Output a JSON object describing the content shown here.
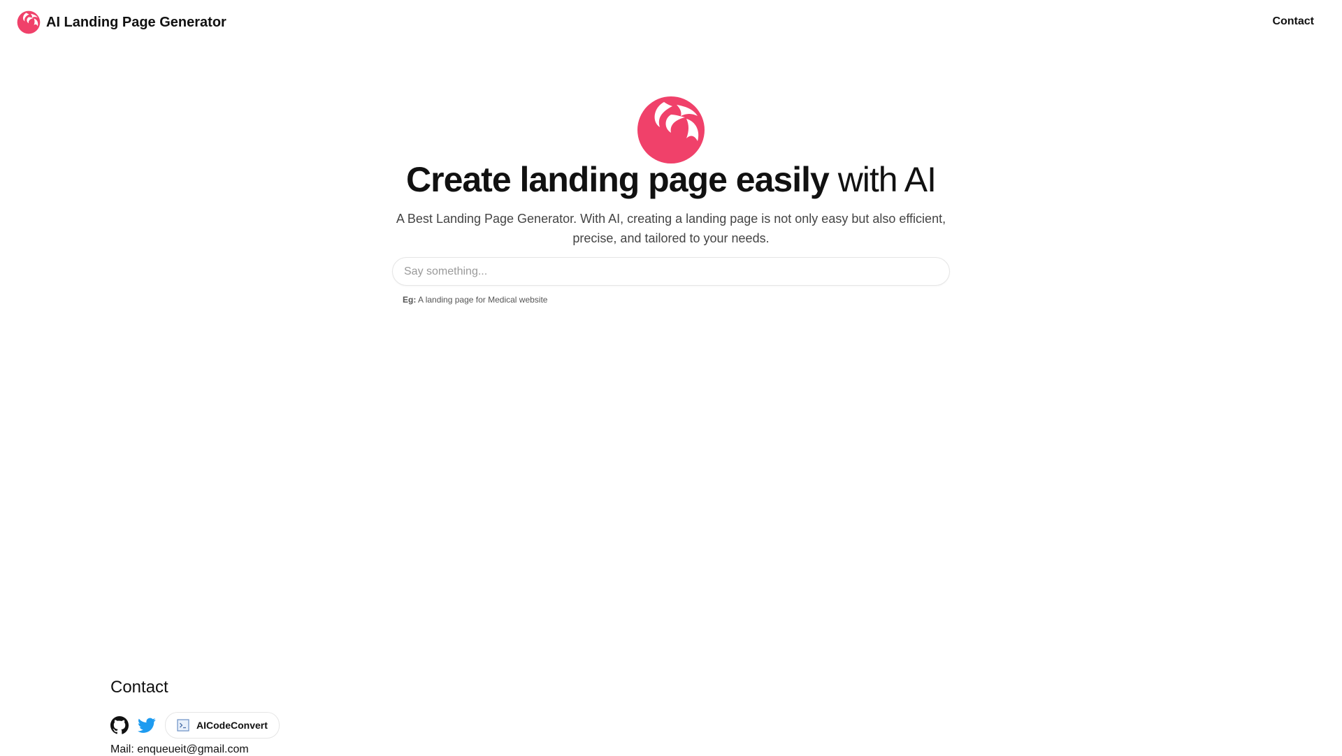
{
  "header": {
    "title": "AI Landing Page Generator",
    "contact_label": "Contact"
  },
  "hero": {
    "headline_bold": "Create landing page easily",
    "headline_light": "with AI",
    "subtitle": "A Best Landing Page Generator. With AI, creating a landing page is not only easy but also efficient, precise, and tailored to your needs.",
    "input_placeholder": "Say something...",
    "input_value": "",
    "example_label": "Eg:",
    "example_text": "A landing page for Medical website"
  },
  "footer": {
    "title": "Contact",
    "links": [
      "github-icon",
      "twitter-icon"
    ],
    "aicodeconvert_label": "AICodeConvert",
    "mail": "Mail: enqueueit@gmail.com"
  },
  "colors": {
    "brand": "#f0416a",
    "twitter": "#1d9bf0"
  }
}
